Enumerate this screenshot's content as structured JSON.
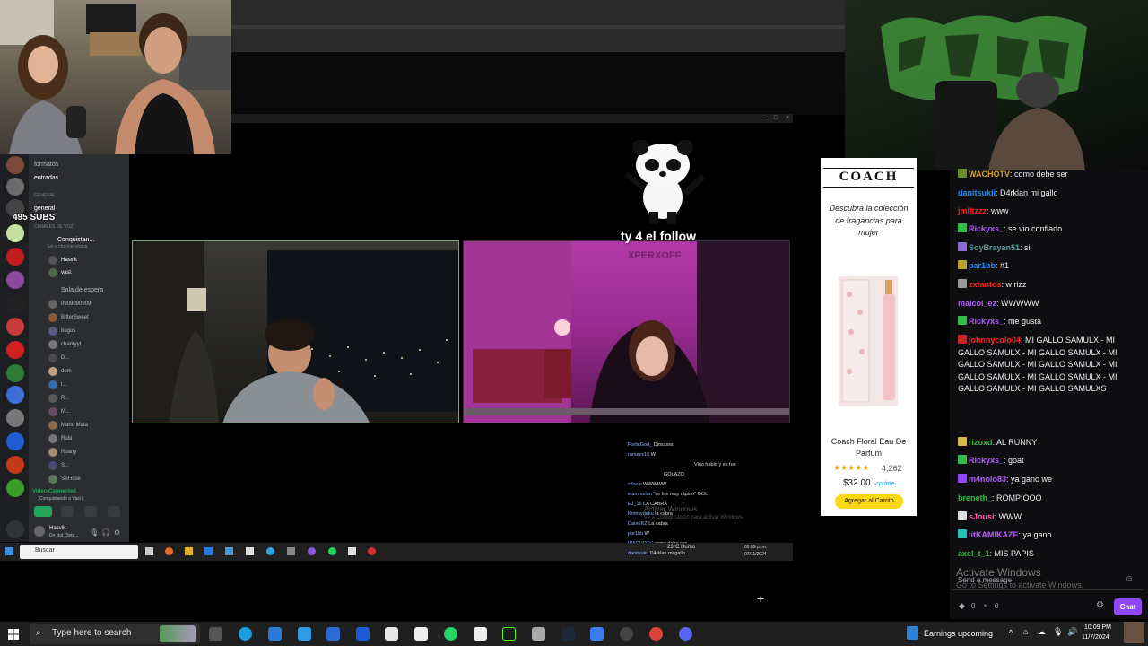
{
  "alert": {
    "text": "ty 4 el follow",
    "sub": "XPERXOFF"
  },
  "subs": "495 SUBS",
  "discord": {
    "channels": [
      "formatos",
      "entradas",
      "general"
    ],
    "category_general": "GENERAL",
    "category_voice": "CANALES DE VOZ",
    "voice_channel": "Conquistan...",
    "voice_status": "Set a channel status",
    "voice_members": [
      "Hasvik",
      "vasl."
    ],
    "waiting_room": "Sala de espera",
    "waiting_members": [
      "0909090909",
      "BitterSweet",
      "bogos",
      "chantyyt",
      "D...",
      "dom",
      "l...",
      "R...",
      "M...",
      "Mario Mata",
      "Rubi",
      "Ruany",
      "S...",
      "SeFicse"
    ],
    "connection": "Video Connected",
    "connection_sub": "Conquistando a Vasl /",
    "user_name": "Hasvik",
    "user_status": "Do Not Distu..."
  },
  "inner_taskbar": {
    "search": "Buscar"
  },
  "inner_chat": [
    {
      "user": "ForticGod_",
      "text": "Diosssss"
    },
    {
      "user": "ramezz16",
      "text": "W"
    },
    {
      "user": "",
      "text": "Vino hablo y se fue"
    },
    {
      "user": "",
      "text": "GOLAZO"
    },
    {
      "user": "sJousi",
      "text": "WWWWW"
    },
    {
      "user": "eiammelon",
      "text": "\"se fue muy rápido\" GOL"
    },
    {
      "user": "EJ_15",
      "text": "LA CABRA"
    },
    {
      "user": "Krimsydeku",
      "text": "la cabra"
    },
    {
      "user": "DarekKZ",
      "text": "La cabra"
    },
    {
      "user": "par1bb",
      "text": "W"
    },
    {
      "user": "WACHOTV",
      "text": "como debe ser"
    },
    {
      "user": "danitsukii",
      "text": "D4rklan mi gallo"
    }
  ],
  "inner_tray": {
    "weather": "23°C Humo",
    "time": "09:09 p. m.",
    "date": "07/11/2024",
    "activate": "Activar Windows",
    "activate_sub": "Ve a Configuración para activar Windows."
  },
  "ad": {
    "brand": "COACH",
    "tagline": "Descubra la colección de fragancias para mujer",
    "product": "Coach Floral Eau De Parfum",
    "stars": "★★★★★",
    "rating": "4,262",
    "price": "$32.00",
    "prime": "✓prime",
    "cta": "Agregar al Carrito"
  },
  "chat": {
    "messages": [
      {
        "user": "WACHOTV",
        "color": "#daa520",
        "badge": "#6b8e23",
        "text": ": como debe ser"
      },
      {
        "user": "danitsukii",
        "color": "#1e90ff",
        "badge": "",
        "text": ": D4rklan mi gallo"
      },
      {
        "user": "jmiltzzz",
        "color": "#ff2020",
        "badge": "",
        "text": ": www"
      },
      {
        "user": "Rickyxs_",
        "color": "#b65cff",
        "badge": "#2ebd45",
        "text": ": se vio confiado"
      },
      {
        "user": "SoyBrayan51",
        "color": "#5f9ea0",
        "badge": "#8a6bd1",
        "text": ": si"
      },
      {
        "user": "par1bb",
        "color": "#1e90ff",
        "badge": "#b8a12a",
        "text": ": #1"
      },
      {
        "user": "zxtantos",
        "color": "#ff2020",
        "badge": "#999999",
        "text": ": w rizz"
      },
      {
        "user": "maicol_ez",
        "color": "#b65cff",
        "badge": "",
        "text": ": WWWWW"
      },
      {
        "user": "Rickyxs_",
        "color": "#b65cff",
        "badge": "#2ebd45",
        "text": ": me gusta"
      },
      {
        "user": "johnnycolo04",
        "color": "#ff2020",
        "badge": "#cc2222",
        "text": ": MI GALLO SAMULX - MI GALLO SAMULX - MI GALLO SAMULX - MI GALLO SAMULX - MI GALLO SAMULX - MI GALLO SAMULX - MI GALLO SAMULX - MI GALLO SAMULX - MI GALLO SAMULXS"
      },
      {
        "user": "rizoxd",
        "color": "#2ebd45",
        "badge": "#d6b94a",
        "text": ": AL RUNNY"
      },
      {
        "user": "Rickyxs_",
        "color": "#b65cff",
        "badge": "#2ebd45",
        "text": ": goat"
      },
      {
        "user": "m4nolo83",
        "color": "#b65cff",
        "badge": "#9147ff",
        "text": ": ya gano we"
      },
      {
        "user": "breneth_",
        "color": "#2ebd45",
        "badge": "",
        "text": ": ROMPIOOO"
      },
      {
        "user": "sJousi",
        "color": "#ff69b4",
        "badge": "#dddddd",
        "text": ": WWW"
      },
      {
        "user": "iitKAMIKAZE",
        "color": "#b65cff",
        "badge": "#22c4b8",
        "text": ": ya gano"
      },
      {
        "user": "axel_t_1",
        "color": "#2ebd45",
        "badge": "",
        "text": ": MIS PAPIS"
      }
    ],
    "input_placeholder": "Send a message",
    "points_a": "0",
    "points_b": "0",
    "send_label": "Chat",
    "watermark_a": "Activate Windows",
    "watermark_b": "Go to Settings to activate Windows."
  },
  "taskbar": {
    "search_placeholder": "Type here to search",
    "news": "Earnings upcoming",
    "time": "10:09 PM",
    "date": "11/7/2024"
  }
}
